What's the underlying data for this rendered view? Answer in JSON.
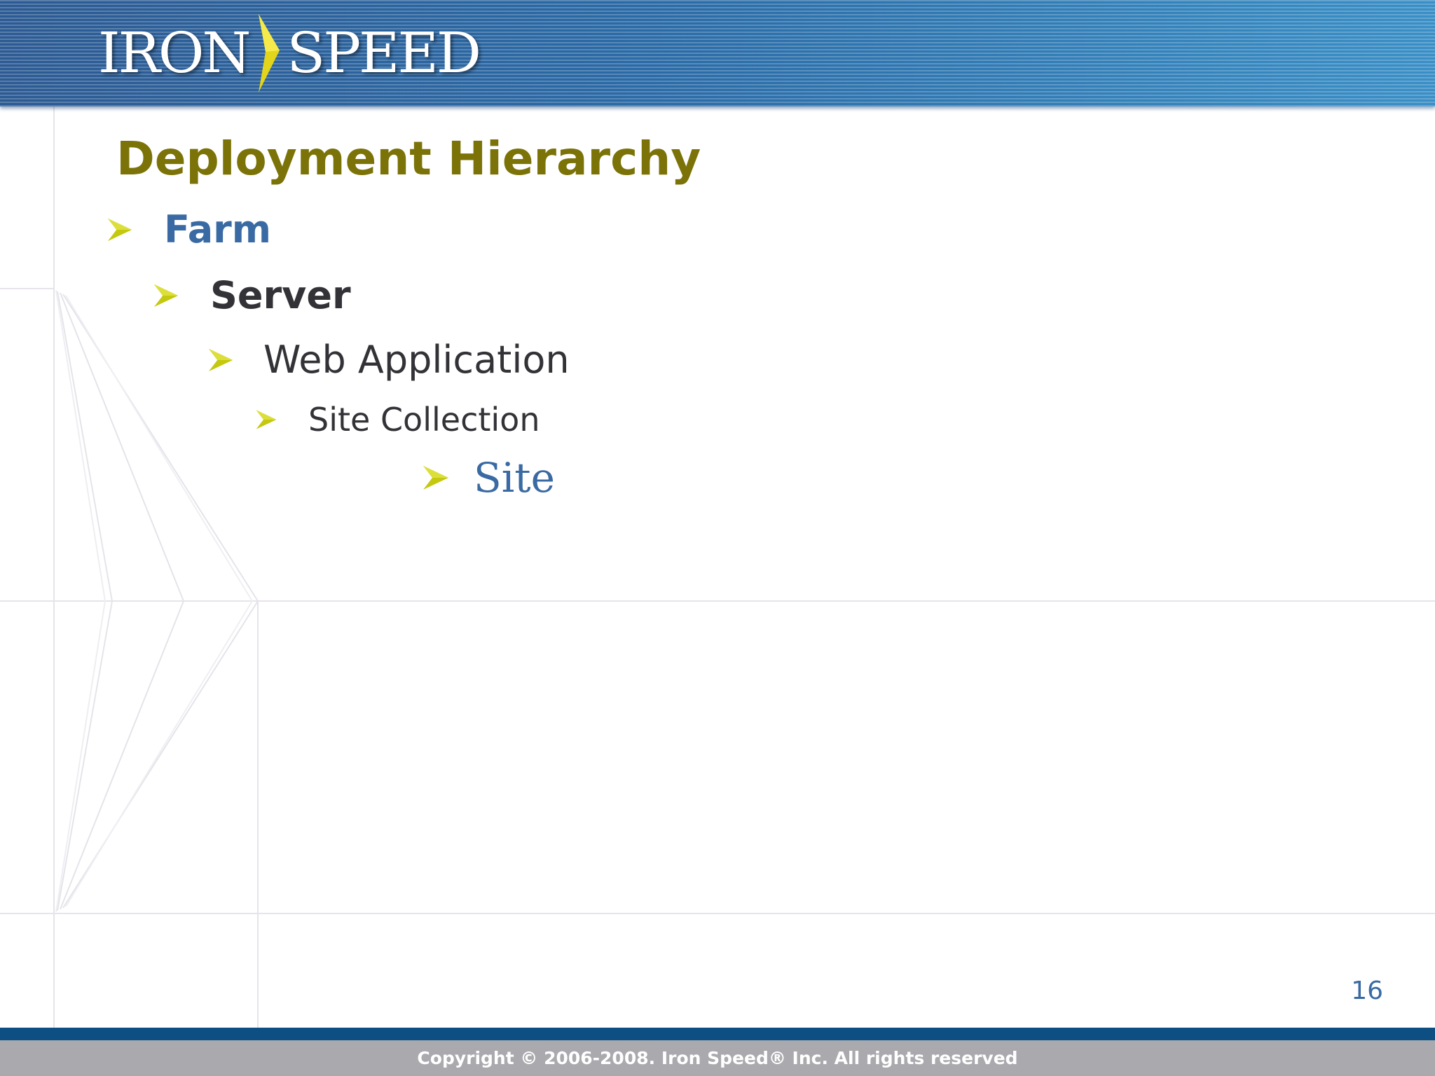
{
  "header": {
    "logo_text_left": "IRON",
    "logo_text_right": "SPEED",
    "logo_chevron_icon": "chevron-right-icon"
  },
  "slide": {
    "title": "Deployment Hierarchy",
    "bullet_icon": "arrowhead-bullet-icon",
    "items": [
      {
        "label": "Farm",
        "level": 1
      },
      {
        "label": "Server",
        "level": 2
      },
      {
        "label": "Web Application",
        "level": 3
      },
      {
        "label": "Site Collection",
        "level": 4
      },
      {
        "label": "Site",
        "level": 5
      }
    ],
    "page_number": "16"
  },
  "footer": {
    "copyright": "Copyright © 2006-2008. Iron Speed® Inc. All rights reserved"
  },
  "colors": {
    "header_blue": "#2a6aa6",
    "title_olive": "#7b7308",
    "bullet_yellow": "#c4c80e",
    "text_blue": "#3a6aa3",
    "text_dark": "#333237",
    "footer_bar": "#0d4f82",
    "footer_gray": "#a9a9ae"
  }
}
